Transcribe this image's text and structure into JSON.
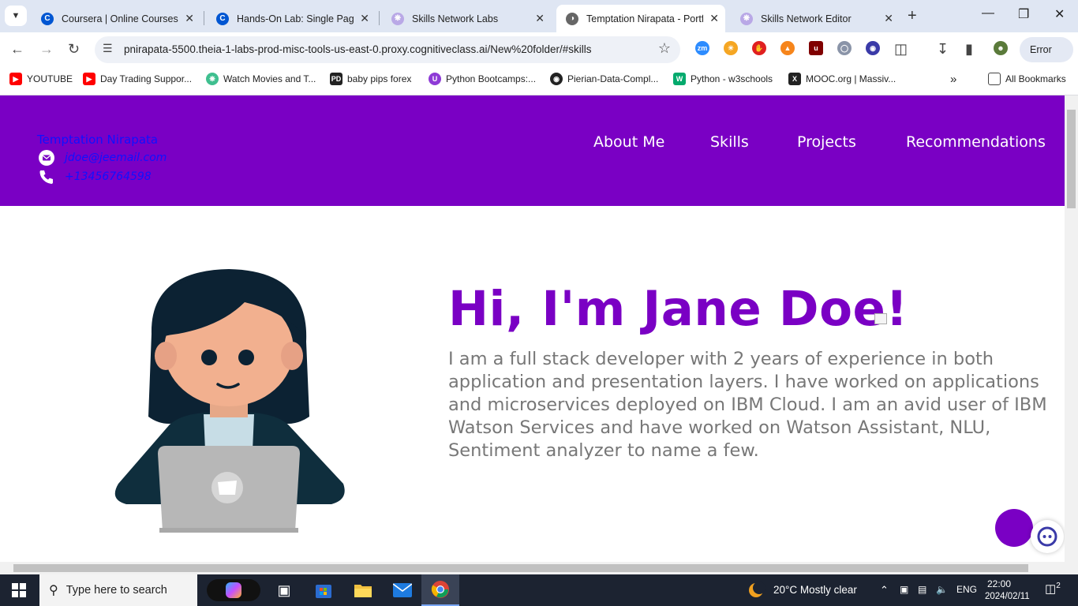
{
  "browser": {
    "tabs": [
      {
        "title": "Coursera | Online Courses &",
        "favicon": "coursera-icon"
      },
      {
        "title": "Hands-On Lab: Single Page",
        "favicon": "coursera-icon"
      },
      {
        "title": "Skills Network Labs",
        "favicon": "skills-network-icon"
      },
      {
        "title": "Temptation Nirapata - Portfo",
        "favicon": "globe-icon"
      },
      {
        "title": "Skills Network Editor",
        "favicon": "skills-network-icon"
      }
    ],
    "active_tab": 3,
    "url": "pnirapata-5500.theia-1-labs-prod-misc-tools-us-east-0.proxy.cognitiveclass.ai/New%20folder/#skills",
    "profile_status": "Error",
    "bookmarks": [
      {
        "label": "YOUTUBE"
      },
      {
        "label": "Day Trading Suppor..."
      },
      {
        "label": "Watch Movies and T..."
      },
      {
        "label": "baby pips forex"
      },
      {
        "label": "Python Bootcamps:..."
      },
      {
        "label": "Pierian-Data-Compl..."
      },
      {
        "label": "Python - w3schools"
      },
      {
        "label": "MOOC.org | Massiv..."
      }
    ],
    "all_bookmarks_label": "All Bookmarks"
  },
  "site": {
    "contact": {
      "name": "Temptation Nirapata",
      "email": "jdoe@jeemail.com",
      "phone": "+13456764598"
    },
    "nav": [
      "About Me",
      "Skills",
      "Projects",
      "Recommendations"
    ],
    "hero": {
      "title": "Hi, I'm Jane Doe!",
      "text": "I am a full stack developer with 2 years of experience in both application and presentation layers. I have worked on applications and microservices deployed on IBM Cloud. I am an avid user of IBM Watson Services and have worked on Watson Assistant, NLU, Sentiment analyzer to name a few."
    },
    "colors": {
      "brand": "#7a00c4",
      "link": "#1010ff",
      "text": "#777777"
    }
  },
  "taskbar": {
    "search_placeholder": "Type here to search",
    "weather": "20°C  Mostly clear",
    "language": "ENG",
    "time": "22:00",
    "date": "2024/02/11",
    "notifications": "2"
  }
}
